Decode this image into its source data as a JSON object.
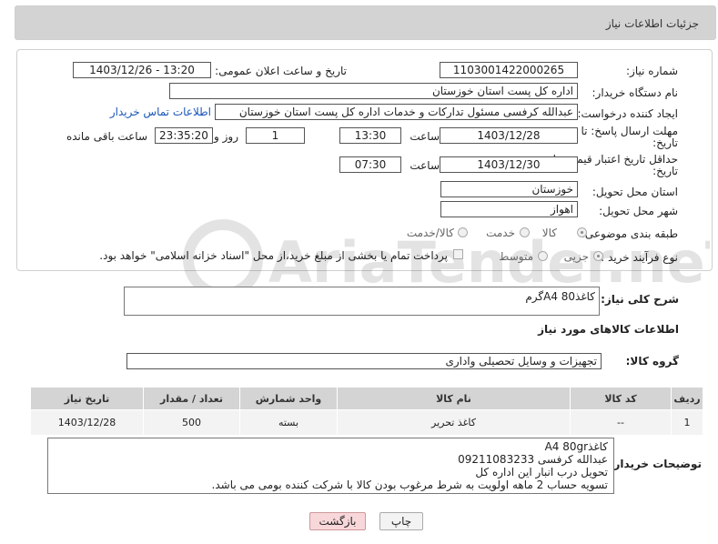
{
  "header": {
    "title": "جزئیات اطلاعات نیاز"
  },
  "form": {
    "need_number": {
      "label": "شماره نیاز:",
      "value": "1103001422000265"
    },
    "announce_datetime": {
      "label": "تاریخ و ساعت اعلان عمومی:",
      "value": "1403/12/26 - 13:20"
    },
    "buyer_org": {
      "label": "نام دستگاه خریدار:",
      "value": "اداره کل پست استان خوزستان"
    },
    "requester": {
      "label": "ایجاد کننده درخواست:",
      "value": "عبدالله کرفسی مسئول تدارکات و خدمات اداره کل پست استان خوزستان",
      "contact_link": "اطلاعات تماس خریدار"
    },
    "reply_deadline": {
      "label_line1": "مهلت ارسال پاسخ: تا",
      "label_line2": "تاریخ:",
      "date": "1403/12/28",
      "time_label": "ساعت",
      "time": "13:30",
      "days": "1",
      "days_label": "روز و",
      "remaining": "23:35:20",
      "remaining_label": "ساعت باقی مانده"
    },
    "price_validity": {
      "label_line1": "حداقل تاریخ اعتبار قیمت: تا",
      "label_line2": "تاریخ:",
      "date": "1403/12/30",
      "time_label": "ساعت",
      "time": "07:30"
    },
    "province": {
      "label": "استان محل تحویل:",
      "value": "خوزستان"
    },
    "city": {
      "label": "شهر محل تحویل:",
      "value": "اهواز"
    },
    "category": {
      "label": "طبقه بندی موضوعی:",
      "options": [
        "کالا",
        "خدمت",
        "کالا/خدمت"
      ],
      "selected": "کالا"
    },
    "process_type": {
      "label": "نوع فرآیند خرید :",
      "options": [
        "جزیی",
        "متوسط"
      ],
      "selected": "جزیی",
      "payment_note": "پرداخت تمام یا بخشی از مبلغ خرید،از محل \"اسناد خزانه اسلامی\" خواهد بود."
    }
  },
  "description": {
    "label": "شرح کلی نیاز:",
    "value": "کاغذA4 80گرم"
  },
  "goods_info": {
    "title": "اطلاعات کالاهای مورد نیاز"
  },
  "goods_group": {
    "label": "گروه کالا:",
    "value": "تجهیزات و وسایل تحصیلی واداری"
  },
  "table": {
    "headers": [
      "ردیف",
      "کد کالا",
      "نام کالا",
      "واحد شمارش",
      "تعداد / مقدار",
      "تاریخ نیاز"
    ],
    "rows": [
      {
        "row": "1",
        "code": "--",
        "name": "کاغذ تحریر",
        "unit": "بسته",
        "qty": "500",
        "date": "1403/12/28"
      }
    ]
  },
  "buyer_notes": {
    "label": "توضیحات خریدار:",
    "lines": [
      "کاغذA4 80gr",
      "عبدالله کرفسی 09211083233",
      "تحویل درب انبار این اداره کل",
      "تسویه حساب 2 ماهه اولویت به شرط مرغوب بودن کالا با شرکت کننده بومی می باشد."
    ]
  },
  "buttons": {
    "print": "چاپ",
    "back": "بازگشت"
  },
  "watermark": {
    "text": "AriaTender.neT"
  },
  "colors": {
    "header_bg": "#d3d3d3",
    "link": "#1a55b8",
    "back_button_bg": "#f8d7da",
    "table_header_bg": "#d4d4d4"
  }
}
